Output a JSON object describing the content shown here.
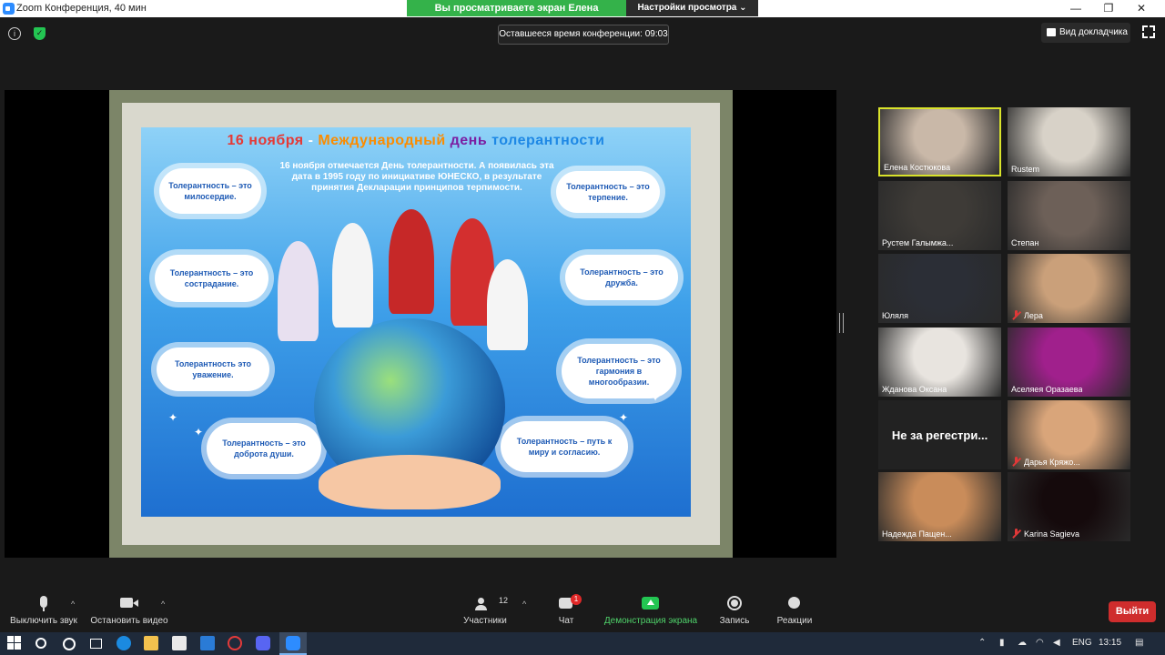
{
  "window": {
    "title": "Zoom Конференция, 40 мин",
    "controls": [
      "—",
      "❐",
      "✕"
    ]
  },
  "share_banner": {
    "viewing_text": "Вы просматриваете экран Елена Костюкова",
    "view_options_label": "Настройки просмотра ⌄"
  },
  "topbar": {
    "timer_text": "Оставшееся время конференции: 09:03",
    "speaker_view_label": "Вид докладчика",
    "info_glyph": "i",
    "shield_glyph": "✓"
  },
  "slide": {
    "title_parts": [
      "16 ноября",
      " - ",
      "Международный",
      " день ",
      "толерантности"
    ],
    "intro_text": "16 ноября отмечается День толерантности. А появилась эта дата в 1995 году по инициативе ЮНЕСКО, в результате принятия Декларации принципов терпимости.",
    "clouds": [
      "Толерантность – это милосердие.",
      "Толерантность – это терпение.",
      "Толерантность – это сострадание.",
      "Толерантность – это дружба.",
      "Толерантность это уважение.",
      "Толерантность – это гармония в многообразии.",
      "Толерантность – это доброта души.",
      "Толерантность – путь к миру и согласию."
    ]
  },
  "participants": [
    {
      "name": "Елена Костюкова",
      "muted": false,
      "active": true,
      "video": true,
      "color": "#c9b8a8"
    },
    {
      "name": "Rustem",
      "muted": false,
      "active": false,
      "video": true,
      "color": "#d8d2c8"
    },
    {
      "name": "Рустем Галымжа...",
      "muted": false,
      "active": false,
      "video": true,
      "color": "#3e3b37"
    },
    {
      "name": "Степан",
      "muted": false,
      "active": false,
      "video": true,
      "color": "#6d6058"
    },
    {
      "name": "Юляля",
      "muted": false,
      "active": false,
      "video": true,
      "color": "#2b2e36"
    },
    {
      "name": "Лера",
      "muted": true,
      "active": false,
      "video": true,
      "color": "#caa07a"
    },
    {
      "name": "Жданова Оксана",
      "muted": false,
      "active": false,
      "video": true,
      "color": "#e8e4df"
    },
    {
      "name": "Аселяея Оразаева",
      "muted": false,
      "active": false,
      "video": true,
      "color": "#a0208c"
    },
    {
      "name": "Не за регестри...",
      "muted": false,
      "active": false,
      "video": false,
      "color": "#222222"
    },
    {
      "name": "Дарья Кряжо...",
      "muted": true,
      "active": false,
      "video": true,
      "color": "#d9a57a"
    },
    {
      "name": "Надежда Пащен...",
      "muted": false,
      "active": false,
      "video": true,
      "color": "#c98c5a"
    },
    {
      "name": "Karina Sagieva",
      "muted": true,
      "active": false,
      "video": true,
      "color": "#150a0c"
    }
  ],
  "toolbar": {
    "mute_label": "Выключить звук",
    "video_label": "Остановить видео",
    "participants_label": "Участники",
    "participants_count": "12",
    "chat_label": "Чат",
    "chat_badge": "1",
    "share_label": "Демонстрация экрана",
    "record_label": "Запись",
    "reactions_label": "Реакции",
    "leave_label": "Выйти",
    "caret_glyph": "^"
  },
  "taskbar": {
    "language": "ENG",
    "time": "13:15"
  },
  "colors": {
    "accent_green": "#34b24a",
    "leave_red": "#cf2d2d",
    "active_speaker": "#d9e32b",
    "taskbar_bg": "#1f2a3a"
  }
}
